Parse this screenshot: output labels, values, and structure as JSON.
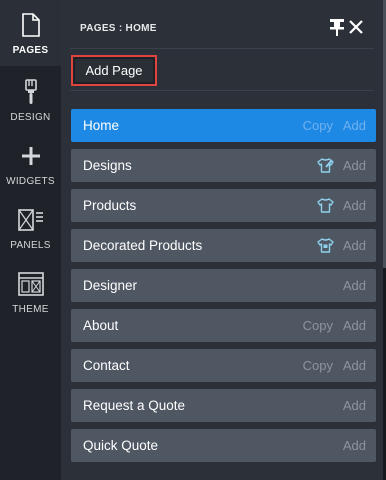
{
  "rail": {
    "items": [
      {
        "label": "PAGES",
        "icon": "page-icon",
        "active": true
      },
      {
        "label": "DESIGN",
        "icon": "brush-icon",
        "active": false
      },
      {
        "label": "WIDGETS",
        "icon": "plus-icon",
        "active": false
      },
      {
        "label": "PANELS",
        "icon": "panels-icon",
        "active": false
      },
      {
        "label": "THEME",
        "icon": "theme-icon",
        "active": false
      }
    ]
  },
  "panel": {
    "title": "PAGES : HOME",
    "add_page_label": "Add Page"
  },
  "pages": [
    {
      "name": "Home",
      "copy": "Copy",
      "add": "Add",
      "active": true
    },
    {
      "name": "Designs",
      "icon": "tshirt-design-icon",
      "add": "Add"
    },
    {
      "name": "Products",
      "icon": "tshirt-icon",
      "add": "Add"
    },
    {
      "name": "Decorated Products",
      "icon": "tshirt-decorated-icon",
      "add": "Add"
    },
    {
      "name": "Designer",
      "add": "Add"
    },
    {
      "name": "About",
      "copy": "Copy",
      "add": "Add"
    },
    {
      "name": "Contact",
      "copy": "Copy",
      "add": "Add"
    },
    {
      "name": "Request a Quote",
      "add": "Add"
    },
    {
      "name": "Quick Quote",
      "add": "Add"
    }
  ],
  "colors": {
    "accent": "#1e88e5",
    "highlight_border": "#e0443e",
    "row": "#4f5763",
    "panel": "#2c3139",
    "rail": "#1f2329",
    "tee_icon": "#8fd0ec"
  }
}
